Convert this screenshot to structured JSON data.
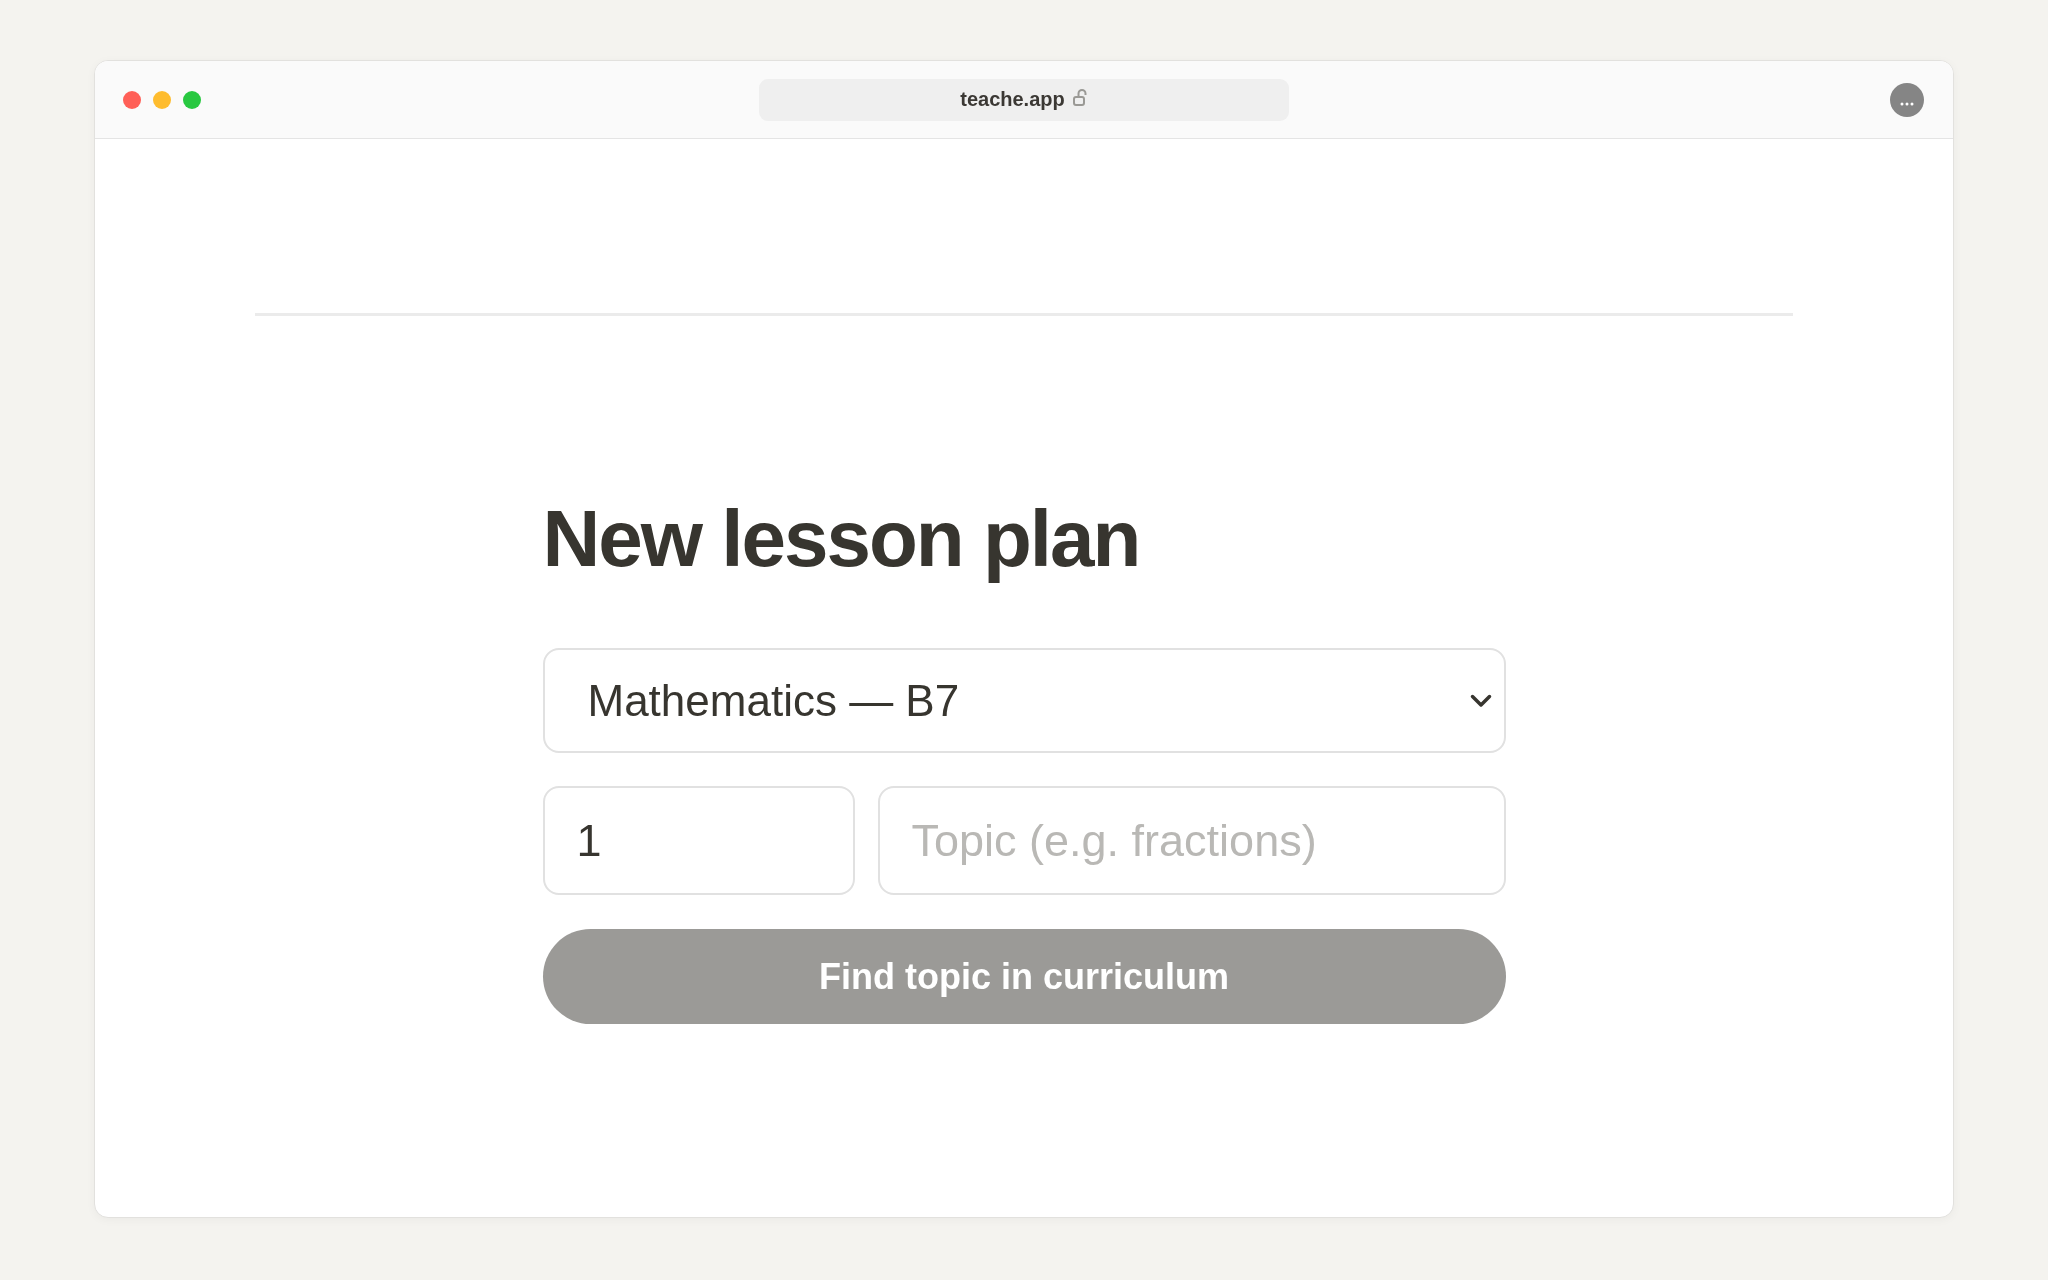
{
  "browser": {
    "address": "teache.app"
  },
  "page": {
    "title": "New lesson plan",
    "subject_select": {
      "value": "Mathematics — B7"
    },
    "number_field": {
      "value": "1"
    },
    "topic_field": {
      "placeholder": "Topic (e.g. fractions)"
    },
    "submit_button": {
      "label": "Find topic in curriculum",
      "disabled": true
    }
  }
}
